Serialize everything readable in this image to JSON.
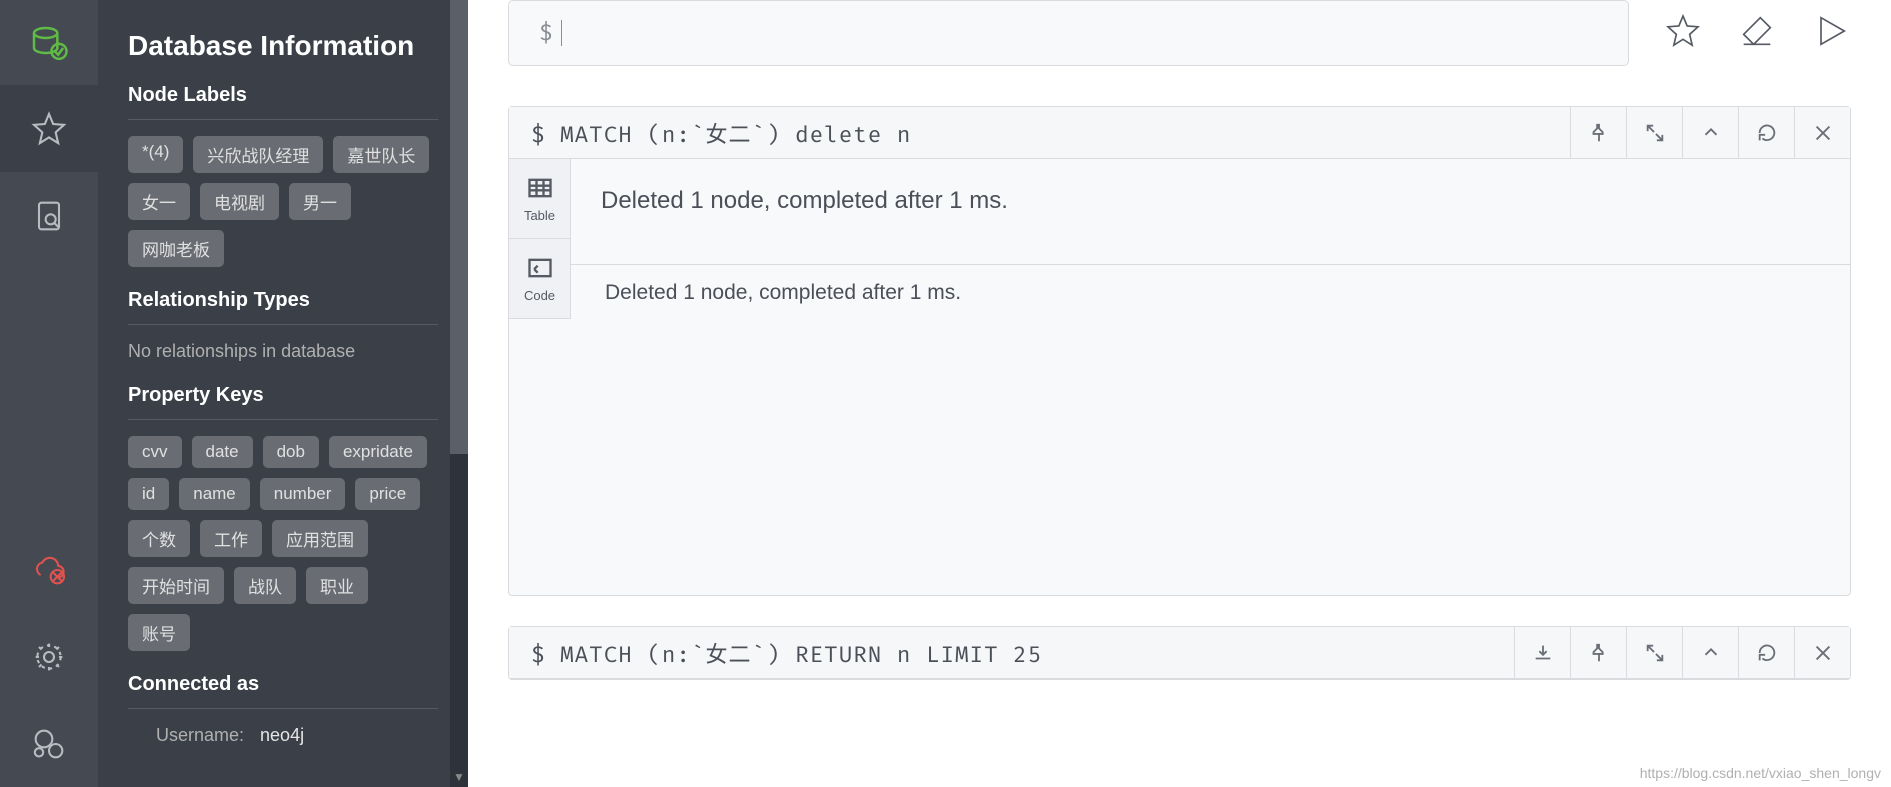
{
  "sidebar": {
    "title": "Database Information",
    "sections": {
      "node_labels": {
        "heading": "Node Labels",
        "tags": [
          "*(4)",
          "兴欣战队经理",
          "嘉世队长",
          "女一",
          "电视剧",
          "男一",
          "网咖老板"
        ]
      },
      "rel_types": {
        "heading": "Relationship Types",
        "empty_text": "No relationships in database"
      },
      "prop_keys": {
        "heading": "Property Keys",
        "tags": [
          "cvv",
          "date",
          "dob",
          "expridate",
          "id",
          "name",
          "number",
          "price",
          "个数",
          "工作",
          "应用范围",
          "开始时间",
          "战队",
          "职业",
          "账号"
        ]
      },
      "connected": {
        "heading": "Connected as",
        "username_label": "Username:",
        "username_value": "neo4j"
      }
    }
  },
  "editor": {
    "prompt": "$"
  },
  "cards": [
    {
      "query_prompt": "$",
      "query": "MATCH (n:`女二`) delete n",
      "view_tabs": {
        "table": "Table",
        "code": "Code"
      },
      "result_text": "Deleted 1 node, completed after 1 ms.",
      "footer_text": "Deleted 1 node, completed after 1 ms.",
      "actions": [
        "pin",
        "expand",
        "collapse",
        "refresh",
        "close"
      ]
    },
    {
      "query_prompt": "$",
      "query": "MATCH (n:`女二`) RETURN n LIMIT 25",
      "actions": [
        "download",
        "pin",
        "expand",
        "collapse",
        "refresh",
        "close"
      ]
    }
  ],
  "watermark": "https://blog.csdn.net/vxiao_shen_longv"
}
